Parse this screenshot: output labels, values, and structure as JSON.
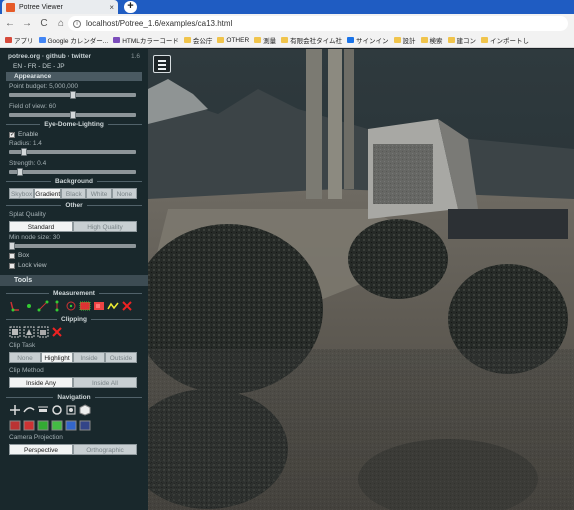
{
  "browser": {
    "tab_title": "Potree Viewer",
    "tab_close": "×",
    "new_tab": "+",
    "url": "localhost/Potree_1.6/examples/ca13.html",
    "nav": {
      "back": "←",
      "forward": "→",
      "reload": "C",
      "home": "⌂"
    },
    "info": "i",
    "bookmarks": [
      {
        "label": "アプリ",
        "color": "#d64a3b"
      },
      {
        "label": "Google カレンダー...",
        "color": "#4285f4"
      },
      {
        "label": "HTMLカラーコード",
        "color": "#7c4dbb"
      },
      {
        "label": "会公庁",
        "color": "#f0c44c"
      },
      {
        "label": "OTHER",
        "color": "#f0c44c"
      },
      {
        "label": "測量",
        "color": "#f0c44c"
      },
      {
        "label": "有限会社タイム社",
        "color": "#f0c44c"
      },
      {
        "label": "サインイン",
        "color": "#1a73e8"
      },
      {
        "label": "設計",
        "color": "#f0c44c"
      },
      {
        "label": "検索",
        "color": "#f0c44c"
      },
      {
        "label": "建コン",
        "color": "#f0c44c"
      },
      {
        "label": "インポートし",
        "color": "#f0c44c"
      }
    ]
  },
  "sidebar": {
    "header": "potree.org · github · twitter",
    "version": "1.6",
    "languages": "EN - FR - DE - JP",
    "appearance": {
      "title": "Appearance",
      "point_budget_label": "Point budget: 5,000,000",
      "point_budget_fraction": 0.5,
      "fov_label": "Field of view: 60",
      "fov_fraction": 0.5,
      "edl_title": "Eye-Dome-Lighting",
      "edl_enable_label": "Enable",
      "edl_enabled": true,
      "radius_label": "Radius: 1.4",
      "radius_fraction": 0.1,
      "strength_label": "Strength: 0.4",
      "strength_fraction": 0.07,
      "background_title": "Background",
      "background_options": [
        "Skybox",
        "Gradient",
        "Black",
        "White",
        "None"
      ],
      "background_selected": "Gradient",
      "other_title": "Other",
      "splat_quality_label": "Splat Quality",
      "splat_options": [
        "Standard",
        "High Quality"
      ],
      "splat_selected": "Standard",
      "min_node_size_label": "Min node size: 30",
      "min_node_fraction": 0.0,
      "box_label": "Box",
      "lock_view_label": "Lock view"
    },
    "tools": {
      "title": "Tools",
      "measurement_title": "Measurement",
      "clipping_title": "Clipping",
      "clip_task_label": "Clip Task",
      "clip_task_options": [
        "None",
        "Highlight",
        "Inside",
        "Outside"
      ],
      "clip_task_selected": "Highlight",
      "clip_method_label": "Clip Method",
      "clip_method_options": [
        "Inside Any",
        "Inside All"
      ],
      "clip_method_selected": "Inside Any",
      "navigation_title": "Navigation",
      "camera_projection_label": "Camera Projection",
      "camera_options": [
        "Perspective",
        "Orthographic"
      ],
      "camera_selected": "Perspective"
    }
  }
}
